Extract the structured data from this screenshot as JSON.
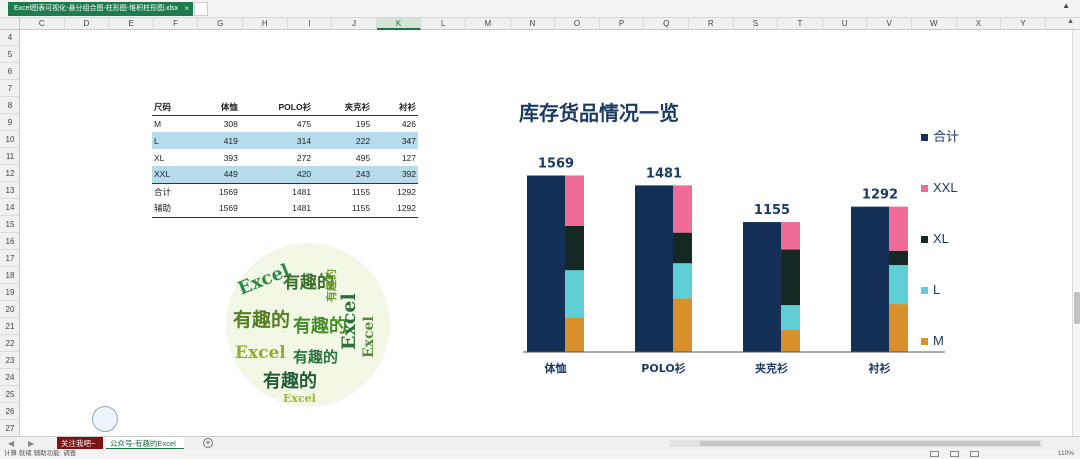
{
  "title_tab": {
    "label": "Excel图表可视化-悬分组合图-柱形图-堆积柱形图.xlsx",
    "close": "×"
  },
  "columns": [
    "C",
    "D",
    "E",
    "F",
    "G",
    "H",
    "I",
    "J",
    "K",
    "L",
    "M",
    "N",
    "O",
    "P",
    "Q",
    "R",
    "S",
    "T",
    "U",
    "V",
    "W",
    "X",
    "Y"
  ],
  "selected_column": "K",
  "rows": [
    "4",
    "5",
    "6",
    "7",
    "8",
    "9",
    "10",
    "11",
    "12",
    "13",
    "14",
    "15",
    "16",
    "17",
    "18",
    "19",
    "20",
    "21",
    "22",
    "23",
    "24",
    "25",
    "26",
    "27"
  ],
  "table": {
    "headers": [
      "尺码",
      "体恤",
      "POLO衫",
      "夹克衫",
      "衬衫"
    ],
    "rows": [
      [
        "M",
        "308",
        "475",
        "195",
        "426"
      ],
      [
        "L",
        "419",
        "314",
        "222",
        "347"
      ],
      [
        "XL",
        "393",
        "272",
        "495",
        "127"
      ],
      [
        "XXL",
        "449",
        "420",
        "243",
        "392"
      ],
      [
        "合计",
        "1569",
        "1481",
        "1155",
        "1292"
      ],
      [
        "辅助",
        "1569",
        "1481",
        "1155",
        "1292"
      ]
    ]
  },
  "wordcloud_words": [
    "Excel",
    "有趣的",
    "有趣的",
    "Excel",
    "有趣的",
    "Excel",
    "有趣的",
    "有趣的",
    "Excel",
    "有趣的",
    "Excel"
  ],
  "chart_data": {
    "type": "bar",
    "title": "库存货品情况一览",
    "categories": [
      "体恤",
      "POLO衫",
      "夹克衫",
      "衬衫"
    ],
    "total_labels": [
      "1569",
      "1481",
      "1155",
      "1292"
    ],
    "series": [
      {
        "name": "合计",
        "values": [
          1569,
          1481,
          1155,
          1292
        ],
        "color": "#143056"
      },
      {
        "name": "M",
        "values": [
          308,
          475,
          195,
          426
        ],
        "color": "#d98f2a"
      },
      {
        "name": "L",
        "values": [
          419,
          314,
          222,
          347
        ],
        "color": "#5ecfd5"
      },
      {
        "name": "XL",
        "values": [
          393,
          272,
          495,
          127
        ],
        "color": "#142824"
      },
      {
        "name": "XXL",
        "values": [
          449,
          420,
          243,
          392
        ],
        "color": "#f06b97"
      }
    ],
    "legend": [
      "合计",
      "XXL",
      "XL",
      "L",
      "M"
    ],
    "legend_position": "right",
    "ylim": [
      0,
      1600
    ],
    "grid": false
  },
  "sheet_tabs": [
    "关注我吧~",
    "公众号-有趣的Excel"
  ],
  "add_sheet": "+",
  "status": {
    "left": "计算   就绪   辅助功能: 调查",
    "zoom": "110%"
  }
}
